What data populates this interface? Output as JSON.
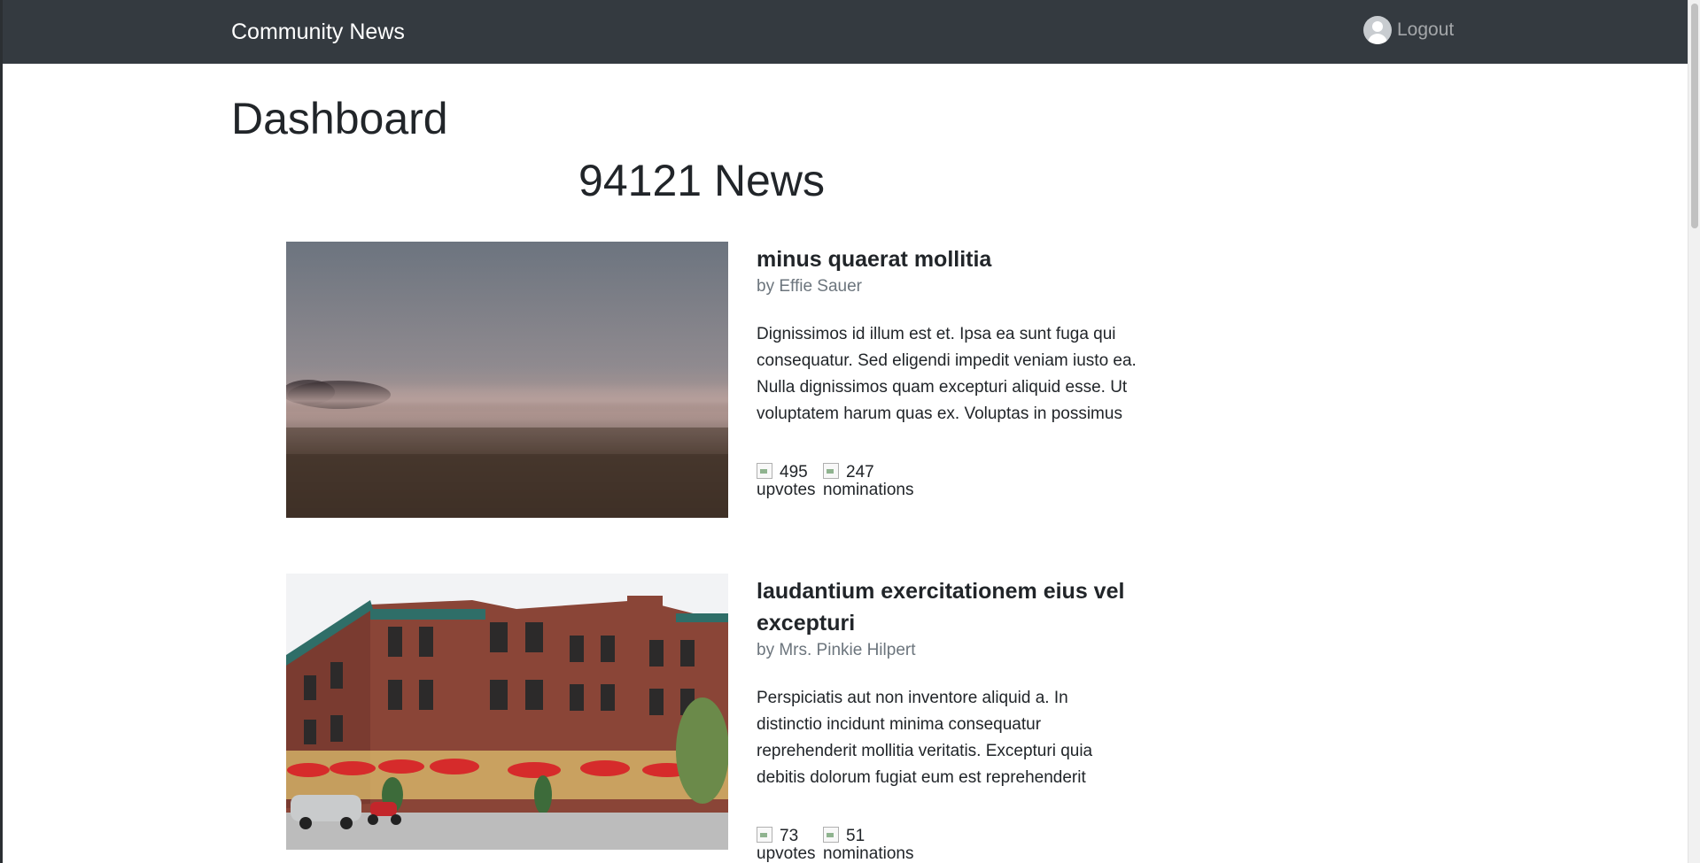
{
  "navbar": {
    "brand": "Community News",
    "logout_label": "Logout"
  },
  "page": {
    "title": "Dashboard",
    "news_heading": "94121 News"
  },
  "articles": [
    {
      "title": "minus quaerat mollitia",
      "author": "by Effie Sauer",
      "body": "Dignissimos id illum est et. Ipsa ea sunt fuga qui consequatur. Sed eligendi impedit veniam iusto ea. Nulla dignissimos quam excepturi aliquid esse. Ut voluptatem harum quas ex. Voluptas in possimus rerum ut exercitationem occaecati ut",
      "upvotes": "495",
      "upvotes_label": "upvotes",
      "nominations": "247",
      "nominations_label": "nominations",
      "image": "foggy-field-photo"
    },
    {
      "title": "laudantium exercitationem eius vel excepturi",
      "author": "by Mrs. Pinkie Hilpert",
      "body": "Perspiciatis aut non inventore aliquid a. In distinctio incidunt minima consequatur reprehenderit mollitia veritatis. Excepturi quia debitis dolorum fugiat eum est reprehenderit",
      "upvotes": "73",
      "upvotes_label": "upvotes",
      "nominations": "51",
      "nominations_label": "nominations",
      "image": "brick-building-cafe-photo"
    }
  ],
  "colors": {
    "navbar_bg": "#343a40",
    "muted_text": "#6c757d"
  }
}
